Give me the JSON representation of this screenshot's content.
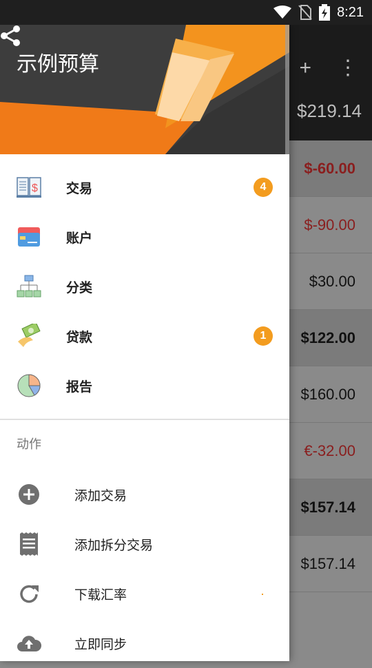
{
  "status_bar": {
    "time": "8:21"
  },
  "toolbar": {
    "add_icon": "plus-icon",
    "more_icon": "more-vert-icon"
  },
  "background": {
    "balance": "$219.14",
    "transactions": [
      {
        "amount": "$-60.00",
        "neg": true,
        "dark": true,
        "bold": true
      },
      {
        "amount": "$-90.00",
        "neg": true,
        "dark": false,
        "bold": false
      },
      {
        "amount": "$30.00",
        "neg": false,
        "dark": false,
        "bold": false
      },
      {
        "amount": "$122.00",
        "neg": false,
        "dark": true,
        "bold": true
      },
      {
        "amount": "$160.00",
        "neg": false,
        "dark": false,
        "bold": false
      },
      {
        "amount": "€-32.00",
        "neg": true,
        "dark": false,
        "bold": false
      },
      {
        "amount": "$157.14",
        "neg": false,
        "dark": true,
        "bold": true
      },
      {
        "amount": "$157.14",
        "neg": false,
        "dark": false,
        "bold": false
      }
    ]
  },
  "drawer": {
    "title": "示例预算",
    "share_icon": "share-icon",
    "nav": [
      {
        "name": "transactions",
        "label": "交易",
        "icon": "ledger-icon",
        "badge": "4"
      },
      {
        "name": "accounts",
        "label": "账户",
        "icon": "credit-card-icon",
        "badge": ""
      },
      {
        "name": "categories",
        "label": "分类",
        "icon": "hierarchy-icon",
        "badge": ""
      },
      {
        "name": "loans",
        "label": "贷款",
        "icon": "money-hand-icon",
        "badge": "1"
      },
      {
        "name": "reports",
        "label": "报告",
        "icon": "pie-chart-icon",
        "badge": ""
      }
    ],
    "actions_title": "动作",
    "actions": [
      {
        "name": "add-transaction",
        "label": "添加交易",
        "icon": "add-circle-icon"
      },
      {
        "name": "add-split-transaction",
        "label": "添加拆分交易",
        "icon": "receipt-icon"
      },
      {
        "name": "download-rates",
        "label": "下载汇率",
        "icon": "refresh-icon"
      },
      {
        "name": "sync-now",
        "label": "立即同步",
        "icon": "cloud-upload-icon"
      }
    ]
  },
  "colors": {
    "accent": "#f39c1f",
    "negative": "#8a1e1e",
    "header_dark": "#3b3b3b"
  }
}
